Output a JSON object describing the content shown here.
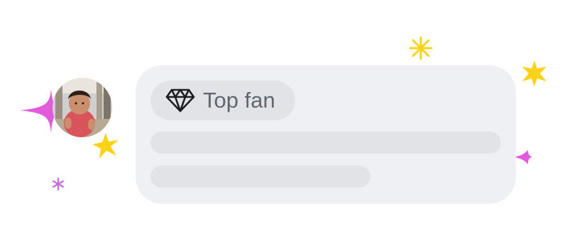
{
  "comment_preview": {
    "author": {
      "avatar_icon": "profile-photo-avatar"
    },
    "badge": {
      "icon": "diamond-icon",
      "label": "Top fan"
    },
    "text_placeholder_lines": 2
  },
  "decorations": {
    "sparkle_colors": {
      "pink": "#e25bdc",
      "yellow": "#fbd21a"
    }
  },
  "colors": {
    "card_background": "#eff0f4",
    "placeholder": "#e2e3e7",
    "badge_text": "#616770"
  }
}
